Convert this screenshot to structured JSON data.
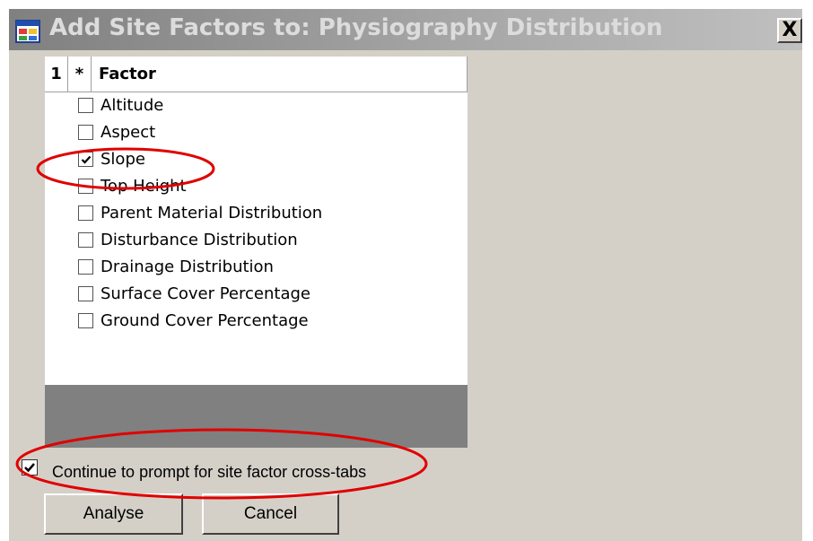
{
  "dialog": {
    "title": "Add Site Factors to: Physiography Distribution",
    "close_label": "X"
  },
  "grid": {
    "columns": [
      "1",
      "*",
      "Factor"
    ],
    "rows": [
      {
        "label": "Altitude",
        "checked": false
      },
      {
        "label": "Aspect",
        "checked": false
      },
      {
        "label": "Slope",
        "checked": true
      },
      {
        "label": "Top Height",
        "checked": false
      },
      {
        "label": "Parent Material Distribution",
        "checked": false
      },
      {
        "label": "Disturbance Distribution",
        "checked": false
      },
      {
        "label": "Drainage Distribution",
        "checked": false
      },
      {
        "label": "Surface Cover Percentage",
        "checked": false
      },
      {
        "label": "Ground Cover Percentage",
        "checked": false
      }
    ]
  },
  "options": {
    "continue_prompt_label": "Continue to prompt for site factor cross-tabs",
    "continue_prompt_checked": true
  },
  "buttons": {
    "analyse_label": "Analyse",
    "cancel_label": "Cancel"
  },
  "colors": {
    "annotation": "#e00000",
    "dialog_background": "#d4d0c8",
    "grid_empty_area": "#808080"
  }
}
